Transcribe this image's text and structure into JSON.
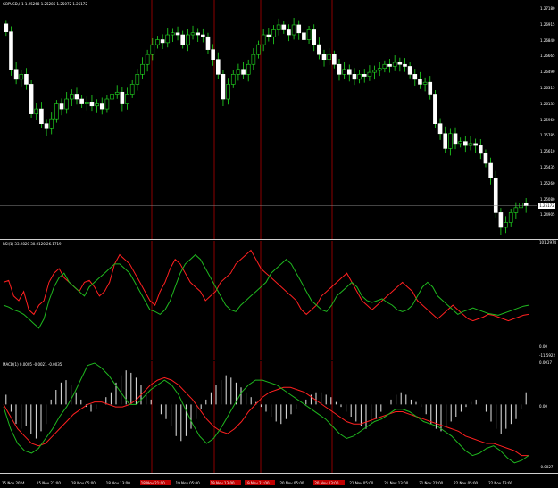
{
  "price_panel": {
    "header": "GBPUSD,H1  1.25268 1.25286 1.25072 1.25172",
    "axis_labels": [
      "1.27180",
      "1.26915",
      "1.26840",
      "1.26665",
      "1.26490",
      "1.26315",
      "1.26135",
      "1.25960",
      "1.25785",
      "1.25610",
      "1.25435",
      "1.25260",
      "1.25080",
      "1.24905"
    ],
    "current_price": "1.25172"
  },
  "rsi_panel": {
    "header": "RSI(1) 33.2820 30.9120 26.1719",
    "axis_top": "101.2974",
    "axis_mid": "0.00",
    "axis_bottom": "-11.5922"
  },
  "macd_panel": {
    "header": "MACD(1) 0.0005 -0.0021 -0.0035",
    "axis_top": "0.0017",
    "axis_mid": "0.00",
    "axis_bottom": "-0.0027"
  },
  "time_axis": [
    {
      "label": "15 Nov 2024",
      "hl": false
    },
    {
      "label": "15 Nov 21:00",
      "hl": false
    },
    {
      "label": "18 Nov 05:00",
      "hl": false
    },
    {
      "label": "18 Nov 13:00",
      "hl": false
    },
    {
      "label": "18 Nov 21:00",
      "hl": true
    },
    {
      "label": "19 Nov 05:00",
      "hl": false
    },
    {
      "label": "19 Nov 13:00",
      "hl": true
    },
    {
      "label": "19 Nov 21:00",
      "hl": true
    },
    {
      "label": "20 Nov 05:00",
      "hl": false
    },
    {
      "label": "20 Nov 13:00",
      "hl": true
    },
    {
      "label": "21 Nov 05:00",
      "hl": false
    },
    {
      "label": "21 Nov 13:00",
      "hl": false
    },
    {
      "label": "21 Nov 21:00",
      "hl": false
    },
    {
      "label": "22 Nov 05:00",
      "hl": false
    },
    {
      "label": "22 Nov 13:00",
      "hl": false
    }
  ],
  "chart_data": [
    {
      "type": "candlestick",
      "title": "GBPUSD,H1",
      "ylim": [
        1.24905,
        1.2718
      ],
      "close": [
        1.2693,
        1.2655,
        1.2645,
        1.265,
        1.264,
        1.261,
        1.2615,
        1.26,
        1.2595,
        1.2605,
        1.262,
        1.2615,
        1.2625,
        1.263,
        1.2625,
        1.262,
        1.2622,
        1.2618,
        1.262,
        1.2615,
        1.2625,
        1.263,
        1.2632,
        1.262,
        1.263,
        1.264,
        1.265,
        1.266,
        1.267,
        1.268,
        1.2685,
        1.2682,
        1.269,
        1.2692,
        1.269,
        1.268,
        1.269,
        1.2692,
        1.269,
        1.2688,
        1.2675,
        1.2665,
        1.265,
        1.2625,
        1.264,
        1.265,
        1.2655,
        1.265,
        1.266,
        1.267,
        1.268,
        1.269,
        1.2688,
        1.2695,
        1.27,
        1.2695,
        1.269,
        1.27,
        1.2692,
        1.2685,
        1.2695,
        1.268,
        1.267,
        1.2665,
        1.267,
        1.266,
        1.265,
        1.2655,
        1.265,
        1.2645,
        1.265,
        1.2648,
        1.2652,
        1.2654,
        1.2656,
        1.266,
        1.2658,
        1.2662,
        1.266,
        1.2658,
        1.265,
        1.2645,
        1.264,
        1.2642,
        1.263,
        1.26,
        1.259,
        1.2575,
        1.259,
        1.258,
        1.2582,
        1.2578,
        1.258,
        1.2578,
        1.257,
        1.256,
        1.2545,
        1.251,
        1.2495,
        1.25,
        1.251,
        1.2515,
        1.252,
        1.2517
      ]
    },
    {
      "type": "line",
      "title": "RSI(1)",
      "ylim": [
        -11.5922,
        101.2974
      ],
      "series": [
        {
          "name": "red",
          "values": [
            60,
            62,
            45,
            40,
            50,
            30,
            25,
            35,
            40,
            60,
            70,
            75,
            65,
            60,
            55,
            50,
            60,
            62,
            55,
            45,
            50,
            60,
            80,
            90,
            85,
            80,
            70,
            60,
            50,
            40,
            35,
            50,
            60,
            75,
            85,
            80,
            70,
            60,
            55,
            50,
            40,
            45,
            50,
            60,
            65,
            70,
            80,
            85,
            90,
            95,
            85,
            75,
            70,
            65,
            60,
            55,
            50,
            45,
            40,
            30,
            25,
            30,
            35,
            45,
            50,
            55,
            60,
            65,
            70,
            60,
            50,
            40,
            35,
            30,
            35,
            40,
            45,
            50,
            55,
            60,
            55,
            50,
            40,
            35,
            30,
            25,
            20,
            25,
            30,
            35,
            30,
            25,
            20,
            18,
            20,
            22,
            25,
            24,
            22,
            20,
            18,
            20,
            22,
            24,
            25
          ]
        },
        {
          "name": "green",
          "values": [
            35,
            33,
            30,
            28,
            25,
            20,
            15,
            10,
            20,
            40,
            55,
            65,
            70,
            60,
            55,
            50,
            45,
            55,
            60,
            65,
            70,
            75,
            80,
            80,
            75,
            70,
            60,
            50,
            40,
            30,
            28,
            25,
            30,
            40,
            55,
            70,
            80,
            85,
            90,
            85,
            75,
            65,
            55,
            45,
            35,
            30,
            28,
            35,
            40,
            45,
            50,
            55,
            60,
            70,
            75,
            80,
            85,
            80,
            70,
            60,
            50,
            40,
            35,
            30,
            28,
            35,
            45,
            50,
            55,
            60,
            55,
            45,
            40,
            38,
            40,
            42,
            38,
            35,
            30,
            28,
            30,
            35,
            45,
            55,
            60,
            55,
            45,
            40,
            35,
            30,
            25,
            28,
            30,
            32,
            30,
            28,
            26,
            25,
            24,
            26,
            28,
            30,
            32,
            34,
            35
          ]
        }
      ]
    },
    {
      "type": "bar",
      "title": "MACD(1)",
      "ylim": [
        -0.0027,
        0.0017
      ],
      "values": [
        0.0004,
        -0.0003,
        -0.0008,
        -0.001,
        -0.0009,
        -0.0012,
        -0.0014,
        -0.0011,
        -0.0008,
        0.0002,
        0.0006,
        0.0009,
        0.001,
        0.0008,
        0.0005,
        0.0002,
        -0.0001,
        -0.0003,
        -0.0002,
        0.0,
        0.0003,
        0.0005,
        0.0009,
        0.0012,
        0.0014,
        0.0013,
        0.0011,
        0.0008,
        0.0005,
        0.0002,
        0.0,
        -0.0004,
        -0.0006,
        -0.0009,
        -0.0013,
        -0.0015,
        -0.0013,
        -0.001,
        -0.0006,
        -0.0002,
        0.0002,
        0.0005,
        0.0008,
        0.001,
        0.0012,
        0.0011,
        0.0009,
        0.0007,
        0.0005,
        0.0003,
        0.0001,
        -0.0001,
        -0.0003,
        -0.0005,
        -0.0007,
        -0.0008,
        -0.0006,
        -0.0004,
        -0.0002,
        0.0,
        0.0002,
        0.0004,
        0.0005,
        0.0005,
        0.0004,
        0.0003,
        0.0001,
        -0.0001,
        -0.0003,
        -0.0005,
        -0.0007,
        -0.0009,
        -0.001,
        -0.0008,
        -0.0006,
        -0.0003,
        0.0,
        0.0002,
        0.0004,
        0.0005,
        0.0004,
        0.0002,
        0.0001,
        -0.0001,
        -0.0004,
        -0.0008,
        -0.001,
        -0.0011,
        -0.0009,
        -0.0007,
        -0.0005,
        -0.0003,
        -0.0001,
        0.0001,
        0.0002,
        0.0,
        -0.0003,
        -0.0007,
        -0.001,
        -0.0012,
        -0.001,
        -0.0008,
        -0.0006,
        -0.0002,
        0.0005
      ],
      "series": [
        {
          "name": "red",
          "values": [
            0.0,
            -0.0005,
            -0.001,
            -0.0013,
            -0.0016,
            -0.0017,
            -0.0016,
            -0.0013,
            -0.001,
            -0.0007,
            -0.0004,
            -0.0002,
            0.0,
            0.0001,
            0.0001,
            0.0,
            -0.0001,
            -0.0001,
            0.0,
            0.0002,
            0.0005,
            0.0008,
            0.001,
            0.0011,
            0.001,
            0.0008,
            0.0005,
            0.0002,
            -0.0002,
            -0.0006,
            -0.0009,
            -0.0011,
            -0.0012,
            -0.001,
            -0.0007,
            -0.0003,
            0.0,
            0.0003,
            0.0005,
            0.0006,
            0.0007,
            0.0007,
            0.0006,
            0.0005,
            0.0003,
            0.0001,
            -0.0001,
            -0.0003,
            -0.0005,
            -0.0007,
            -0.0008,
            -0.0008,
            -0.0007,
            -0.0006,
            -0.0005,
            -0.0004,
            -0.0003,
            -0.0003,
            -0.0004,
            -0.0005,
            -0.0006,
            -0.0007,
            -0.0008,
            -0.0009,
            -0.001,
            -0.0011,
            -0.0013,
            -0.0014,
            -0.0015,
            -0.0016,
            -0.0016,
            -0.0017,
            -0.0018,
            -0.0019,
            -0.0021,
            -0.0021
          ]
        },
        {
          "name": "green",
          "values": [
            -0.0001,
            -0.001,
            -0.0016,
            -0.0019,
            -0.002,
            -0.0018,
            -0.0014,
            -0.001,
            -0.0005,
            -0.0001,
            0.0004,
            0.001,
            0.0016,
            0.0017,
            0.0015,
            0.0012,
            0.0008,
            0.0004,
            0.0,
            0.0,
            0.0003,
            0.0006,
            0.0008,
            0.001,
            0.0008,
            0.0004,
            -0.0002,
            -0.0008,
            -0.0013,
            -0.0016,
            -0.0014,
            -0.001,
            -0.0005,
            0.0,
            0.0005,
            0.0008,
            0.001,
            0.001,
            0.0009,
            0.0008,
            0.0006,
            0.0004,
            0.0002,
            0.0,
            -0.0002,
            -0.0004,
            -0.0006,
            -0.0009,
            -0.0012,
            -0.0014,
            -0.0013,
            -0.0011,
            -0.0009,
            -0.0007,
            -0.0006,
            -0.0004,
            -0.0002,
            -0.0002,
            -0.0003,
            -0.0005,
            -0.0007,
            -0.0008,
            -0.0009,
            -0.0011,
            -0.0013,
            -0.0016,
            -0.0019,
            -0.0021,
            -0.002,
            -0.0018,
            -0.0017,
            -0.0019,
            -0.0022,
            -0.0024,
            -0.0023,
            -0.0021
          ]
        }
      ]
    }
  ]
}
